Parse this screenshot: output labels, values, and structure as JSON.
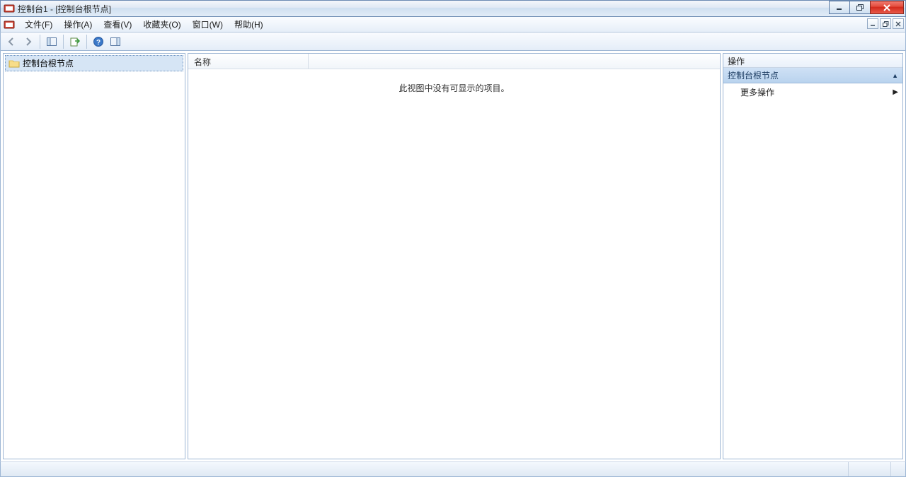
{
  "window": {
    "title": "控制台1 - [控制台根节点]"
  },
  "menubar": {
    "items": [
      "文件(F)",
      "操作(A)",
      "查看(V)",
      "收藏夹(O)",
      "窗口(W)",
      "帮助(H)"
    ]
  },
  "tree": {
    "root_label": "控制台根节点"
  },
  "list": {
    "column_name": "名称",
    "empty_message": "此视图中没有可显示的项目。"
  },
  "actions": {
    "header": "操作",
    "section_title": "控制台根节点",
    "more_actions": "更多操作"
  }
}
